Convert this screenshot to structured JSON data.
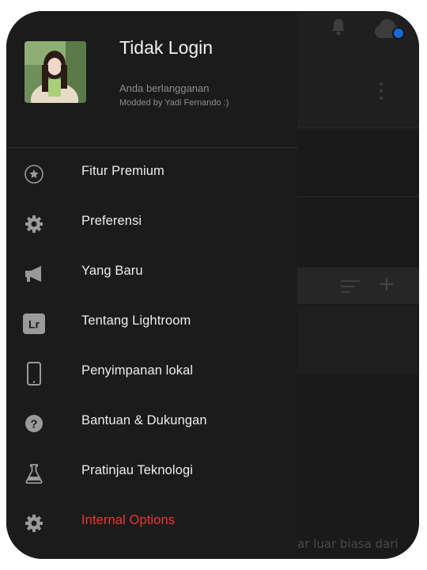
{
  "drawer": {
    "user_name": "Tidak Login",
    "subscription_text": "Anda berlangganan",
    "modded_by": "Modded by Yadi Fernando :)",
    "menu": [
      {
        "label": "Fitur Premium",
        "icon": "star-circle-icon"
      },
      {
        "label": "Preferensi",
        "icon": "gear-icon"
      },
      {
        "label": "Yang Baru",
        "icon": "megaphone-icon"
      },
      {
        "label": "Tentang Lightroom",
        "icon": "lightroom-logo-icon",
        "icon_text": "Lr"
      },
      {
        "label": "Penyimpanan lokal",
        "icon": "phone-device-icon"
      },
      {
        "label": "Bantuan & Dukungan",
        "icon": "help-circle-icon"
      },
      {
        "label": "Pratinjau Teknologi",
        "icon": "flask-icon"
      },
      {
        "label": "Internal Options",
        "icon": "gear-icon",
        "color": "#e8382f"
      }
    ]
  },
  "background": {
    "partial_text": "ar luar biasa dari"
  },
  "colors": {
    "drawer_bg": "#1b1b1b",
    "accent_red": "#e8382f",
    "cloud_sync_dot": "#1769d8"
  }
}
